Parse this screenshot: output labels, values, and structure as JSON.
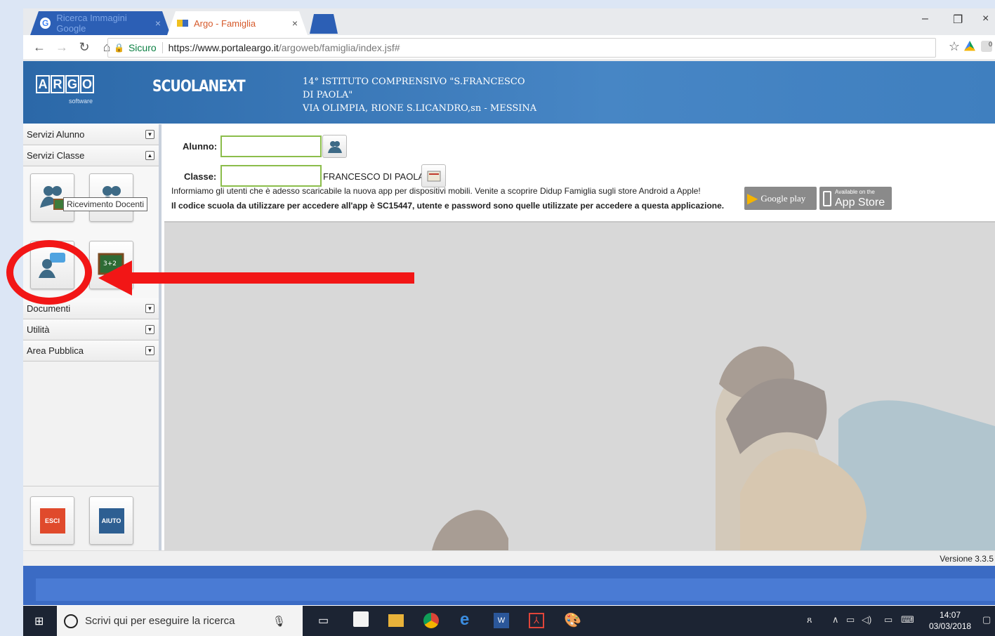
{
  "browser": {
    "tabs": [
      {
        "label": "Ricerca Immagini Google"
      },
      {
        "label": "Argo - Famiglia"
      }
    ],
    "secure_label": "Sicuro",
    "url_host": "https://www.portaleargo.it",
    "url_path": "/argoweb/famiglia/index.jsf#"
  },
  "header": {
    "logo_letters": [
      "A",
      "R",
      "G",
      "O"
    ],
    "logo_sub": "software",
    "product": "SCUOLANEXT",
    "school_line1": "14° ISTITUTO COMPRENSIVO \"S.FRANCESCO",
    "school_line2": "DI PAOLA\"",
    "school_line3": "VIA OLIMPIA, RIONE S.LICANDRO,sn - MESSINA"
  },
  "sidebar": {
    "sections": [
      {
        "label": "Servizi Alunno",
        "toggle": "▼"
      },
      {
        "label": "Servizi Classe",
        "toggle": "▲"
      },
      {
        "label": "Documenti",
        "toggle": "▼"
      },
      {
        "label": "Utilità",
        "toggle": "▼"
      },
      {
        "label": "Area Pubblica",
        "toggle": "▼"
      }
    ],
    "tooltip": "Ricevimento Docenti",
    "exit_label": "ESCI",
    "help_label": "AIUTO"
  },
  "form": {
    "alunno_label": "Alunno:",
    "classe_label": "Classe:",
    "classe_after": "FRANCESCO DI PAOLA",
    "info_line1": "Informiamo gli utenti che è adesso scaricabile la nuova app per dispositivi mobili. Venite a scoprire Didup Famiglia sugli store Android a Apple!",
    "info_line2": "Il codice scuola da utilizzare per accedere all'app è SC15447, utente e password sono quelle utilizzate per accedere a questa applicazione.",
    "google_play": "Google play",
    "app_store_small": "Available on the",
    "app_store": "App Store"
  },
  "footer": {
    "version": "Versione 3.3.5"
  },
  "taskbar": {
    "search_placeholder": "Scrivi qui per eseguire la ricerca",
    "time": "14:07",
    "date": "03/03/2018"
  },
  "colors": {
    "header_blue": "#3f7fbf",
    "annotation_red": "#f21616",
    "field_green": "#8bbd4b"
  }
}
